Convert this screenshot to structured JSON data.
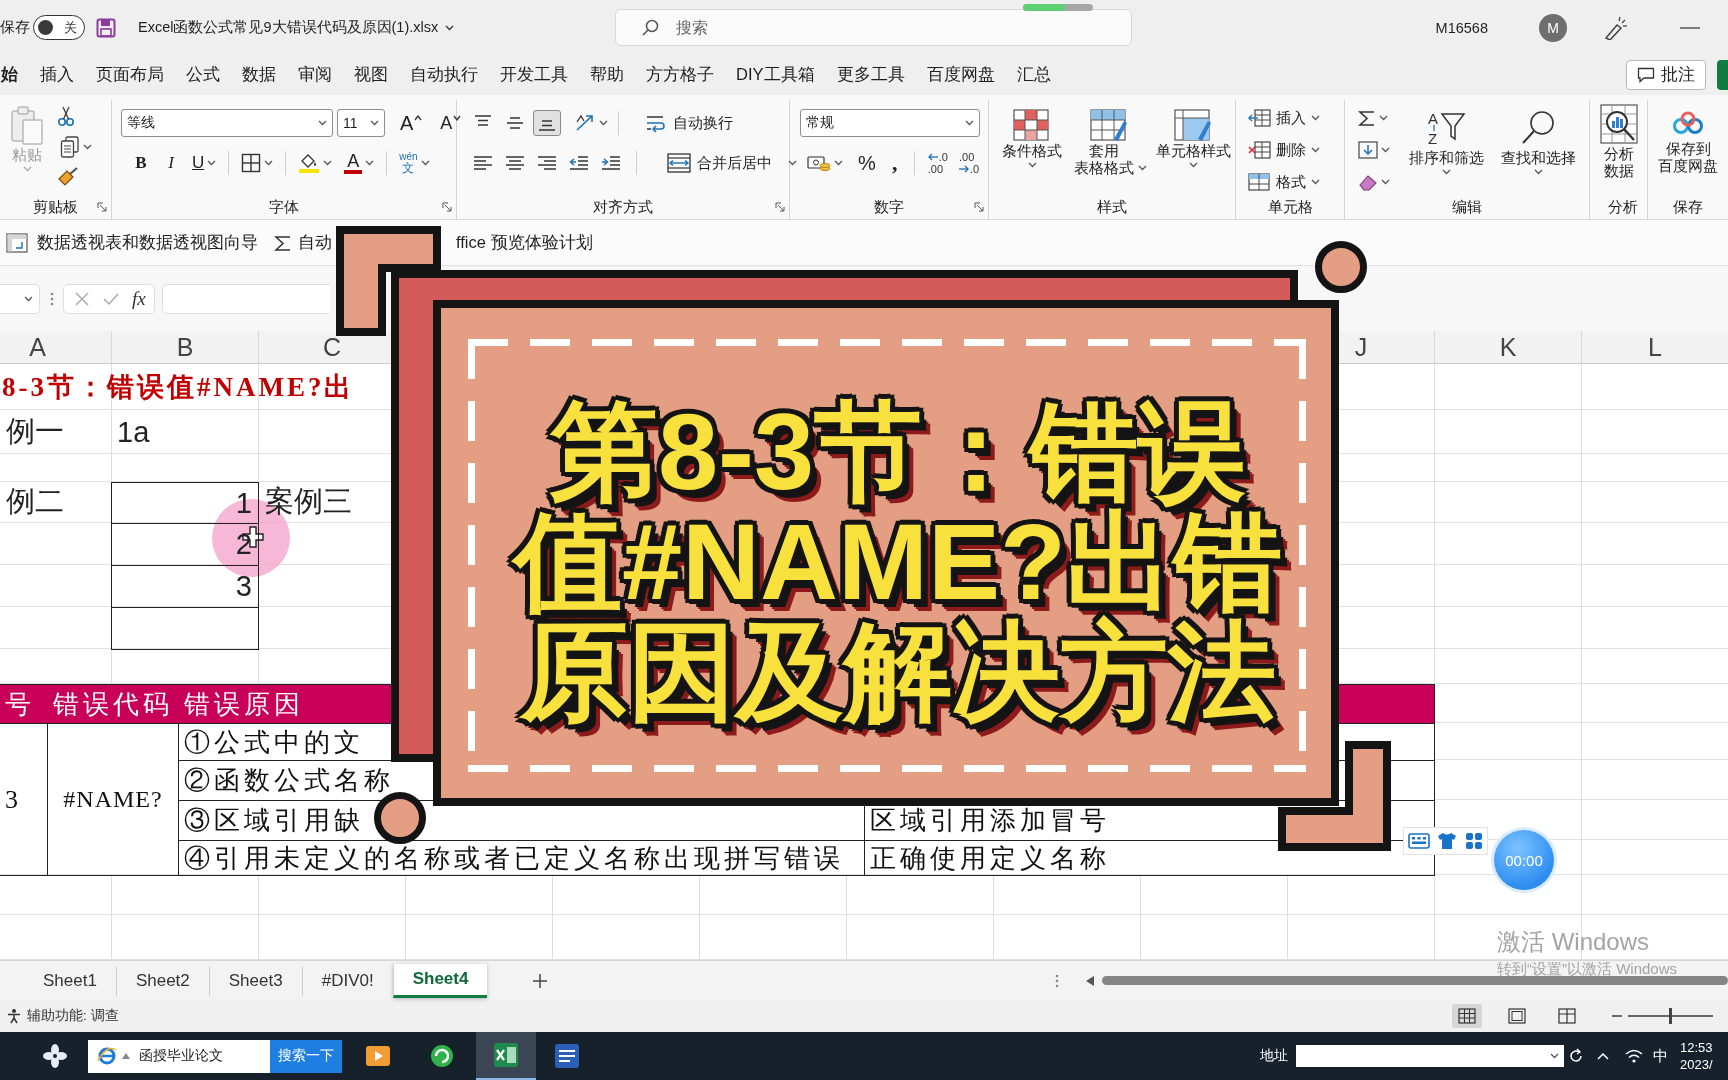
{
  "title_bar": {
    "autosave_label": "保存",
    "autosave": {
      "on": false,
      "label": "关"
    },
    "file_name": "Excel函数公式常见9大错误代码及原因(1).xlsx",
    "search": {
      "placeholder": "搜索"
    },
    "progress": {
      "level": 0.6
    },
    "user_name": "M16568",
    "avatar": "M"
  },
  "ribbon_tabs": [
    {
      "label": "始",
      "selected": true
    },
    {
      "label": "插入",
      "selected": false
    },
    {
      "label": "页面布局",
      "selected": false
    },
    {
      "label": "公式",
      "selected": false
    },
    {
      "label": "数据",
      "selected": false
    },
    {
      "label": "审阅",
      "selected": false
    },
    {
      "label": "视图",
      "selected": false
    },
    {
      "label": "自动执行",
      "selected": false
    },
    {
      "label": "开发工具",
      "selected": false
    },
    {
      "label": "帮助",
      "selected": false
    },
    {
      "label": "方方格子",
      "selected": false
    },
    {
      "label": "DIY工具箱",
      "selected": false
    },
    {
      "label": "更多工具",
      "selected": false
    },
    {
      "label": "百度网盘",
      "selected": false
    },
    {
      "label": "汇总",
      "selected": false
    }
  ],
  "comments_button": "批注",
  "ribbon": {
    "clipboard": {
      "label": "剪贴板",
      "paste": {
        "label": "粘贴",
        "disabled": true
      }
    },
    "font": {
      "label": "字体",
      "font_name": "等线",
      "font_size": "11",
      "grow": "A",
      "shrink": "A",
      "bold": "B",
      "italic": "I",
      "underline": "U",
      "font_color": "A",
      "phonetic": {
        "top": "wén",
        "bottom": "文"
      }
    },
    "alignment": {
      "label": "对齐方式",
      "vertical_align": [
        {
          "selected": false
        },
        {
          "selected": false
        },
        {
          "selected": true
        }
      ],
      "wrap_text": "自动换行",
      "merge_center": "合并后居中"
    },
    "number": {
      "label": "数字",
      "format": "常规",
      "percent": "%",
      "comma": ",",
      "increase_decimal": {
        "top": ".0",
        "bottom": ".00"
      },
      "decrease_decimal": {
        "top": ".00",
        "bottom": ".0"
      }
    },
    "styles": {
      "label": "样式",
      "buttons": [
        "条件格式",
        "套用表格格式",
        "单元格样式"
      ]
    },
    "cells": {
      "label": "单元格",
      "buttons": [
        "插入",
        "删除",
        "格式"
      ]
    },
    "editing": {
      "label": "编辑",
      "sort_filter": {
        "label": "排序和筛选",
        "letters": [
          "A",
          "Z"
        ]
      },
      "find_select": "查找和选择"
    },
    "analysis": {
      "label": "分析",
      "button": "分析数据"
    },
    "save": {
      "label": "保存",
      "button": "保存到百度网盘"
    }
  },
  "quick_bar": {
    "pivot_wizard": "数据透视表和数据透视图向导",
    "autosum": "自动",
    "insider": "ffice 预览体验计划"
  },
  "formula_bar": {
    "fx": "fx"
  },
  "sheet": {
    "columns": [
      "A",
      "B",
      "C",
      "J",
      "K",
      "L"
    ],
    "title": "8-3节：错误值#NAME?出",
    "cases": [
      {
        "a": "例一",
        "b": {
          "text": "1a",
          "kind": "text"
        },
        "bordered": false
      },
      {
        "a": "例二",
        "b": {
          "text": "1",
          "kind": "number"
        },
        "c": "案例三",
        "bordered": true
      },
      {
        "b": {
          "text": "2",
          "kind": "number"
        },
        "bordered": true
      },
      {
        "b": {
          "text": "3",
          "kind": "number"
        },
        "bordered": true
      },
      {
        "bordered": true
      }
    ]
  },
  "error_table": {
    "headers": [
      "号",
      "错误代码",
      "错误原因"
    ],
    "number": "3",
    "code": "#NAME?",
    "rows": [
      {
        "cause": "①公式中的文"
      },
      {
        "cause": "②函数公式名称"
      },
      {
        "cause": "③区域引用缺",
        "fix": "区域引用添加冒号"
      },
      {
        "cause": "④引用未定义的名称或者已定义名称出现拼写错误",
        "fix": "正确使用定义名称"
      }
    ]
  },
  "overlay": {
    "title": "第8-3节：错误值#NAME?出错原因及解决方法"
  },
  "floating": {
    "timer": "00:00"
  },
  "activation": {
    "title": "激活 Windows",
    "hint": "转到“设置”以激活 Windows"
  },
  "sheet_tabs": [
    {
      "label": "Sheet1",
      "selected": false
    },
    {
      "label": "Sheet2",
      "selected": false
    },
    {
      "label": "Sheet3",
      "selected": false
    },
    {
      "label": "#DIV0!",
      "selected": false
    },
    {
      "label": "Sheet4",
      "selected": true
    }
  ],
  "status_bar": {
    "accessibility": "辅助功能: 调查",
    "views": [
      {
        "selected": true
      },
      {
        "selected": false
      },
      {
        "selected": false
      }
    ],
    "zoom": {
      "level": 0.5
    }
  },
  "taskbar": {
    "search": {
      "value": "函授毕业论文"
    },
    "search_button": "搜索一下",
    "apps": [
      {
        "selected": false
      },
      {
        "selected": false
      },
      {
        "selected": true
      },
      {
        "selected": false
      }
    ],
    "address_label": "地址",
    "ime": "中",
    "time": "12:53",
    "date": "2023/"
  }
}
